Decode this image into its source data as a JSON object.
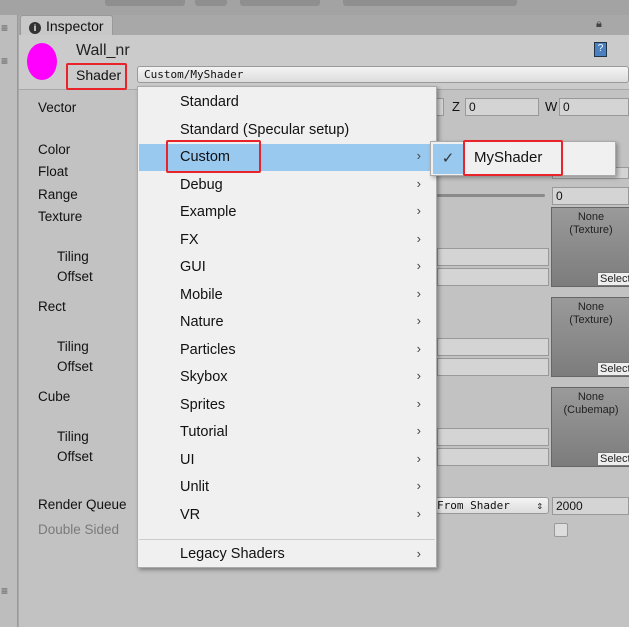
{
  "tab": {
    "title": "Inspector",
    "icon": "info-icon"
  },
  "material": {
    "name": "Wall_nr",
    "shader_label": "Shader",
    "shader_value": "Custom/MyShader",
    "preview_color": "#ff00ff"
  },
  "properties": {
    "vector": {
      "label": "Vector",
      "z_label": "Z",
      "z_value": "0",
      "w_label": "W",
      "w_value": "0"
    },
    "color": "Color",
    "float": "Float",
    "range": {
      "label": "Range",
      "value": "0"
    },
    "texture": {
      "label": "Texture",
      "tiling": "Tiling",
      "offset": "Offset",
      "slot": "None\n(Texture)",
      "select": "Select"
    },
    "rect": {
      "label": "Rect",
      "tiling": "Tiling",
      "offset": "Offset",
      "slot": "None\n(Texture)",
      "select": "Select"
    },
    "cube": {
      "label": "Cube",
      "tiling": "Tiling",
      "offset": "Offset",
      "slot": "None\n(Cubemap)",
      "select": "Select"
    },
    "render_queue": {
      "label": "Render Queue",
      "mode": "From Shader",
      "value": "2000"
    },
    "double_sided": {
      "label": "Double Sided",
      "checked": false
    }
  },
  "menu": {
    "items": [
      {
        "label": "Standard",
        "submenu": false
      },
      {
        "label": "Standard (Specular setup)",
        "submenu": false
      },
      {
        "label": "Custom",
        "submenu": true,
        "highlighted": true
      },
      {
        "label": "Debug",
        "submenu": true
      },
      {
        "label": "Example",
        "submenu": true
      },
      {
        "label": "FX",
        "submenu": true
      },
      {
        "label": "GUI",
        "submenu": true
      },
      {
        "label": "Mobile",
        "submenu": true
      },
      {
        "label": "Nature",
        "submenu": true
      },
      {
        "label": "Particles",
        "submenu": true
      },
      {
        "label": "Skybox",
        "submenu": true
      },
      {
        "label": "Sprites",
        "submenu": true
      },
      {
        "label": "Tutorial",
        "submenu": true
      },
      {
        "label": "UI",
        "submenu": true
      },
      {
        "label": "Unlit",
        "submenu": true
      },
      {
        "label": "VR",
        "submenu": true
      }
    ],
    "legacy": "Legacy Shaders",
    "highlight_color": "#99c9ef"
  },
  "submenu": {
    "items": [
      {
        "label": "MyShader",
        "checked": true
      }
    ]
  },
  "annotation_color": "#e8232a"
}
